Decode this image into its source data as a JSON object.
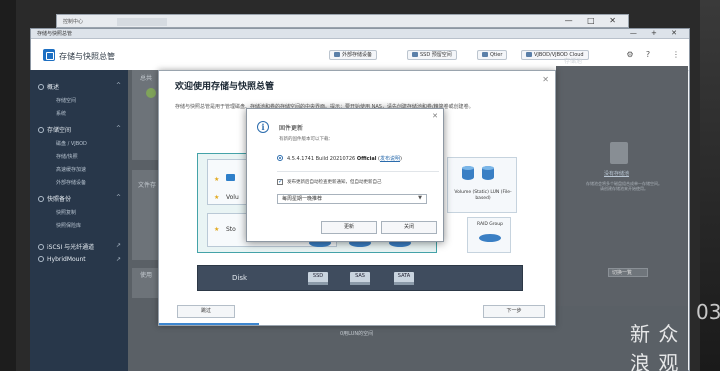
{
  "background_window": {
    "title": "控制中心",
    "controls": "— □ ✕"
  },
  "app": {
    "window_title": "存储与快照总管",
    "window_controls": "— + ✕",
    "name": "存储与快照总管",
    "header_buttons": [
      "外部存储设备",
      "SSD 预留空间",
      "Qtier",
      "VJBOD/VJBOD Cloud"
    ],
    "header_icons": [
      "gear-icon",
      "help-icon",
      "more-icon"
    ]
  },
  "sidebar": {
    "sections": [
      {
        "label": "概述",
        "items": [
          "存储空间",
          "系统"
        ]
      },
      {
        "label": "存储空间",
        "items": [
          "磁盘 / VJBOD",
          "存储/快照",
          "高速缓存加速",
          "外部存储设备"
        ]
      },
      {
        "label": "快照备份",
        "items": [
          "快照复制",
          "快照保险库"
        ]
      }
    ],
    "links": [
      "iSCSI 与光纤通道",
      "HybridMount"
    ]
  },
  "content": {
    "total_label": "总共",
    "deleted_label": "文件存",
    "use_label": "使用",
    "right_panel_title": "存储池",
    "right_panel_link": "没有存储池",
    "right_panel_desc": "存储池会将多个磁盘组合成单一存储空间。请创建存储池来开始使用。",
    "select_value": "切换一覧",
    "footer_note": "0用LUN的空间"
  },
  "welcome": {
    "title": "欢迎使用存储与快照总管",
    "intro": "存储与快照总管是用于管理磁盘、存储池和卷的存储空间的中央界面。提示：要开始使用 NAS，请先创建存储池和卷/精简卷或创建卷。",
    "diagram": {
      "row1_label": "Volu",
      "row2_label": "Sto",
      "volume_label": "Volume (Static) LUN (File-based)",
      "raid_label": "RAID Group",
      "disk_label": "Disk",
      "disk_types": [
        "SSD",
        "SAS",
        "SATA"
      ]
    },
    "skip_button": "跳过",
    "next_button": "下一步"
  },
  "update_dialog": {
    "title": "固件更新",
    "subtitle": "有新的固件版本可以下载：",
    "version_prefix": "4.5.4.1741 Build 20210726",
    "version_tag": "Official",
    "release_notes_link": "发布说明",
    "auto_check_label": "发布更新后自动检查更新通知，但自动更新自己",
    "schedule_value": "每周星期一晚推荐",
    "update_button": "更新",
    "close_button": "关闭"
  },
  "watermark": {
    "logo": "新众浪观",
    "site": "众观 新浪",
    "num": "03"
  }
}
